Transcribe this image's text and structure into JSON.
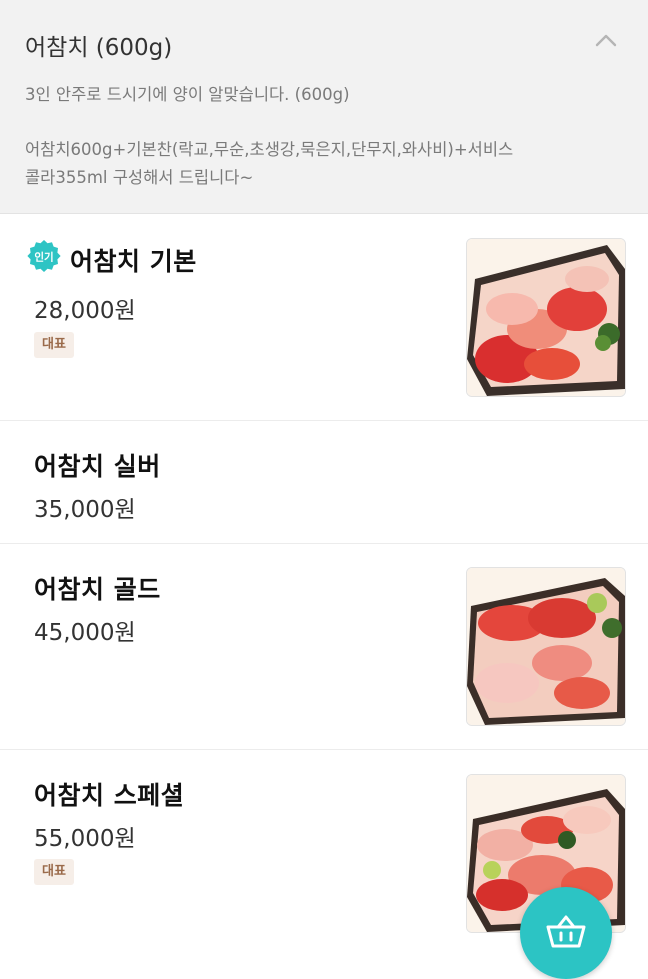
{
  "option": {
    "title": "어참치 (600g)",
    "description_line1": "3인 안주로 드시기에 양이 알맞습니다. (600g)",
    "description_line2": "어참치600g+기본찬(락교,무순,초생강,묵은지,단무지,와사비)+서비스",
    "description_line3": "콜라355ml 구성해서 드립니다~",
    "toggle_icon": "chevron-up-icon"
  },
  "badges": {
    "popular_label": "인기",
    "popular_color": "#2ec4c4",
    "representative_label": "대표"
  },
  "menu": [
    {
      "name": "어참치 기본",
      "price": "28,000원",
      "popular": true,
      "representative": true,
      "has_image": true
    },
    {
      "name": "어참치 실버",
      "price": "35,000원",
      "popular": false,
      "representative": false,
      "has_image": false
    },
    {
      "name": "어참치 골드",
      "price": "45,000원",
      "popular": false,
      "representative": false,
      "has_image": true
    },
    {
      "name": "어참치 스페셜",
      "price": "55,000원",
      "popular": false,
      "representative": true,
      "has_image": true
    }
  ],
  "cart_button": {
    "icon": "basket-icon",
    "color": "#2cc4c4"
  }
}
